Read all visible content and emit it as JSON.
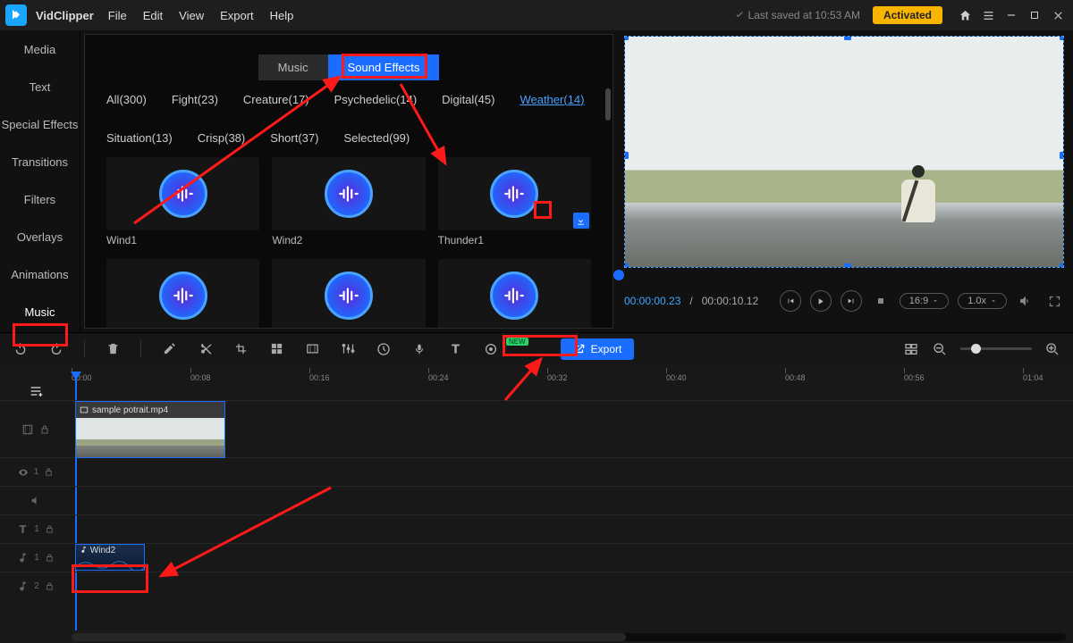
{
  "app": {
    "name": "VidClipper"
  },
  "menu": [
    "File",
    "Edit",
    "View",
    "Export",
    "Help"
  ],
  "status": {
    "saved": "Last saved at 10:53 AM",
    "activated": "Activated"
  },
  "sidebar": [
    "Media",
    "Text",
    "Special Effects",
    "Transitions",
    "Filters",
    "Overlays",
    "Animations",
    "Music"
  ],
  "sidebar_active": 7,
  "library": {
    "tabs": {
      "music": "Music",
      "sfx": "Sound Effects"
    },
    "tabs_active": "sfx",
    "cats": [
      {
        "label": "All",
        "count": 300
      },
      {
        "label": "Fight",
        "count": 23
      },
      {
        "label": "Creature",
        "count": 17
      },
      {
        "label": "Psychedelic",
        "count": 14
      },
      {
        "label": "Digital",
        "count": 45
      },
      {
        "label": "Weather",
        "count": 14
      },
      {
        "label": "Situation",
        "count": 13
      },
      {
        "label": "Crisp",
        "count": 38
      },
      {
        "label": "Short",
        "count": 37
      },
      {
        "label": "Selected",
        "count": 99
      }
    ],
    "cats_active": 5,
    "clips": [
      "Wind1",
      "Wind2",
      "Thunder1",
      "",
      "",
      ""
    ]
  },
  "preview": {
    "time_current": "00:00:00.23",
    "time_total": "00:00:10.12",
    "aspect": "16:9",
    "speed": "1.0x"
  },
  "toolbar": {
    "export": "Export",
    "new": "NEW"
  },
  "ruler": [
    "00:00",
    "00:08",
    "00:16",
    "00:24",
    "00:32",
    "00:40",
    "00:48",
    "00:56",
    "01:04"
  ],
  "timeline": {
    "video_clip": "sample potrait.mp4",
    "audio_clip": "Wind2",
    "track_nums": {
      "a": "1",
      "b": "1",
      "c": "1",
      "d": "2"
    }
  }
}
